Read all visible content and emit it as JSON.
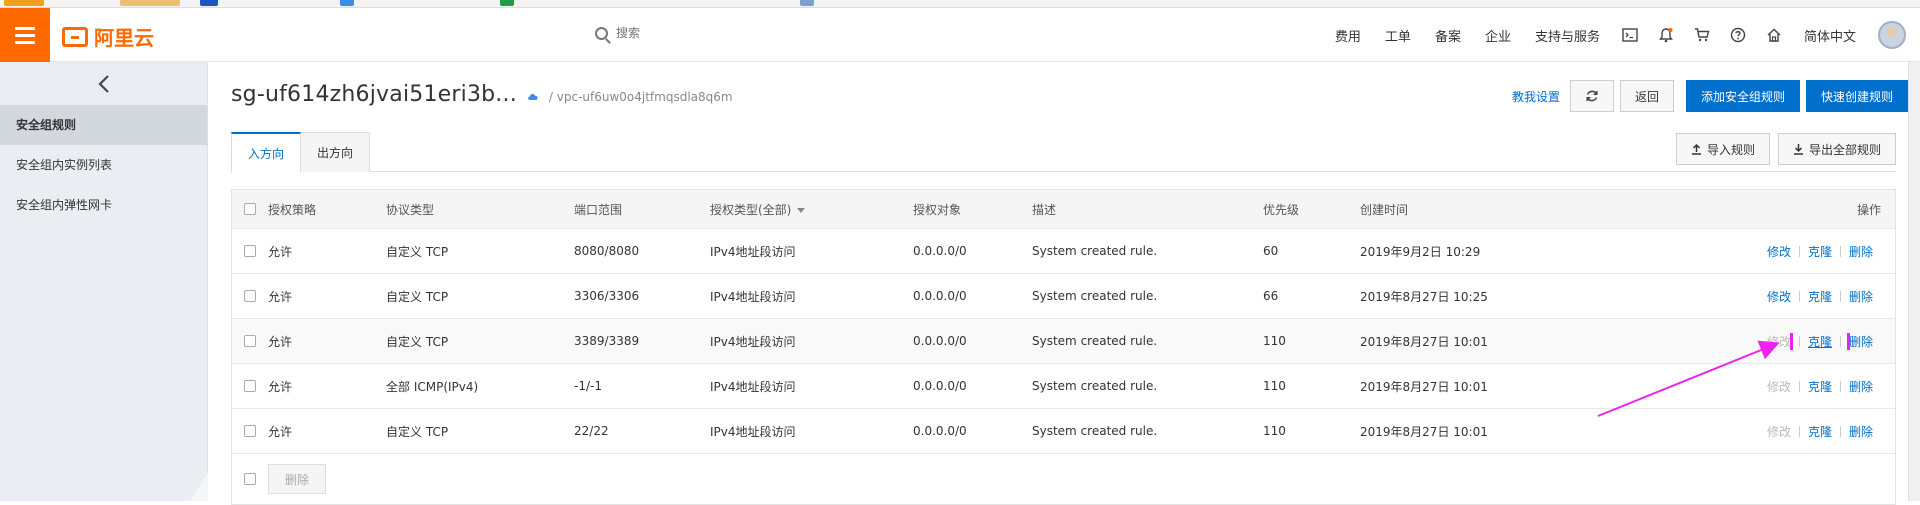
{
  "topbar": {
    "brand": "阿里云",
    "search_placeholder": "搜索",
    "nav_links": [
      "费用",
      "工单",
      "备案",
      "企业",
      "支持与服务"
    ],
    "language": "简体中文"
  },
  "sidebar": {
    "items": [
      {
        "label": "安全组规则",
        "active": true
      },
      {
        "label": "安全组内实例列表",
        "active": false
      },
      {
        "label": "安全组内弹性网卡",
        "active": false
      }
    ]
  },
  "page": {
    "title": "sg-uf614zh6jvai51eri3b...",
    "breadcrumb": "/ vpc-uf6uw0o4jtfmqsdla8q6m",
    "help_link": "教我设置",
    "back_button": "返回",
    "add_rule_button": "添加安全组规则",
    "quick_create_button": "快速创建规则",
    "import_button": "导入规则",
    "export_button": "导出全部规则"
  },
  "tabs": [
    {
      "label": "入方向",
      "active": true
    },
    {
      "label": "出方向",
      "active": false
    }
  ],
  "table": {
    "headers": {
      "policy": "授权策略",
      "protocol": "协议类型",
      "port": "端口范围",
      "auth_type": "授权类型(全部)",
      "target": "授权对象",
      "description": "描述",
      "priority": "优先级",
      "created": "创建时间",
      "ops": "操作"
    },
    "rows": [
      {
        "policy": "允许",
        "protocol": "自定义 TCP",
        "port": "8080/8080",
        "auth_type": "IPv4地址段访问",
        "target": "0.0.0.0/0",
        "description": "System created rule.",
        "priority": "60",
        "created": "2019年9月2日 10:29",
        "edit": "修改",
        "clone": "克隆",
        "delete": "删除",
        "edit_enabled": true
      },
      {
        "policy": "允许",
        "protocol": "自定义 TCP",
        "port": "3306/3306",
        "auth_type": "IPv4地址段访问",
        "target": "0.0.0.0/0",
        "description": "System created rule.",
        "priority": "66",
        "created": "2019年8月27日 10:25",
        "edit": "修改",
        "clone": "克隆",
        "delete": "删除",
        "edit_enabled": true
      },
      {
        "policy": "允许",
        "protocol": "自定义 TCP",
        "port": "3389/3389",
        "auth_type": "IPv4地址段访问",
        "target": "0.0.0.0/0",
        "description": "System created rule.",
        "priority": "110",
        "created": "2019年8月27日 10:01",
        "edit": "修改",
        "clone": "克隆",
        "delete": "删除",
        "edit_enabled": false
      },
      {
        "policy": "允许",
        "protocol": "全部 ICMP(IPv4)",
        "port": "-1/-1",
        "auth_type": "IPv4地址段访问",
        "target": "0.0.0.0/0",
        "description": "System created rule.",
        "priority": "110",
        "created": "2019年8月27日 10:01",
        "edit": "修改",
        "clone": "克隆",
        "delete": "删除",
        "edit_enabled": false
      },
      {
        "policy": "允许",
        "protocol": "自定义 TCP",
        "port": "22/22",
        "auth_type": "IPv4地址段访问",
        "target": "0.0.0.0/0",
        "description": "System created rule.",
        "priority": "110",
        "created": "2019年8月27日 10:01",
        "edit": "修改",
        "clone": "克隆",
        "delete": "删除",
        "edit_enabled": false
      }
    ],
    "bulk_delete_button": "删除"
  },
  "annotation": {
    "color": "#ee22ee"
  },
  "colors": {
    "brand": "#ff6a00",
    "primary": "#0070cc"
  }
}
